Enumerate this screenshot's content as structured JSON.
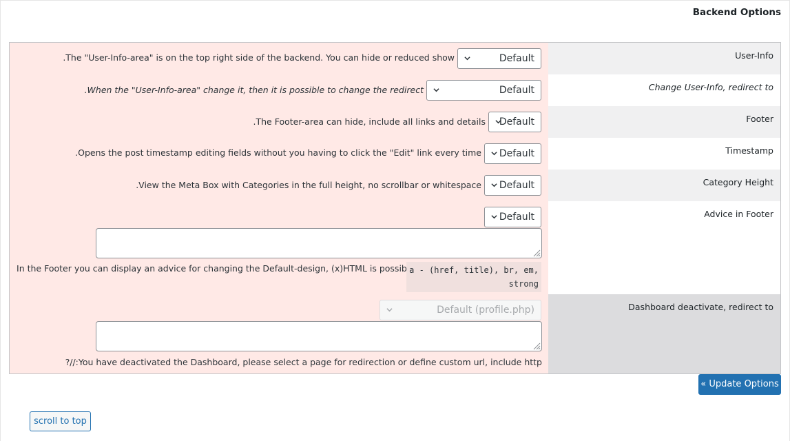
{
  "section": {
    "title": "Backend Options"
  },
  "rows": [
    {
      "label": "User-Info",
      "select": "Default",
      "description": ".The \"User-Info-area\" is on the top right side of the backend. You can hide or reduced show"
    },
    {
      "label": "Change User-Info, redirect to",
      "select": "Default",
      "description": ".When the \"User-Info-area\" change it, then it is possible to change the redirect"
    },
    {
      "label": "Footer",
      "select": "Default",
      "description": ".The Footer-area can hide, include all links and details"
    },
    {
      "label": "Timestamp",
      "select": "Default",
      "description": ".Opens the post timestamp editing fields without you having to click the \"Edit\" link every time"
    },
    {
      "label": "Category Height",
      "select": "Default",
      "description": ".View the Meta Box with Categories in the full height, no scrollbar or whitespace"
    },
    {
      "label": "Advice in Footer",
      "select": "Default",
      "textarea": "",
      "description": "In the Footer you can display an advice for changing the Default-design, (x)HTML is possible.",
      "code_line1": "a - (href, title), br, em,",
      "code_line2": "strong"
    },
    {
      "label": "Dashboard deactivate, redirect to",
      "select": "Default (profile.php)",
      "textarea": "",
      "description": "?//:You have deactivated the Dashboard, please select a page for redirection or define custom url, include http"
    }
  ],
  "buttons": {
    "update": "« Update Options",
    "scroll_top": "scroll to top"
  }
}
